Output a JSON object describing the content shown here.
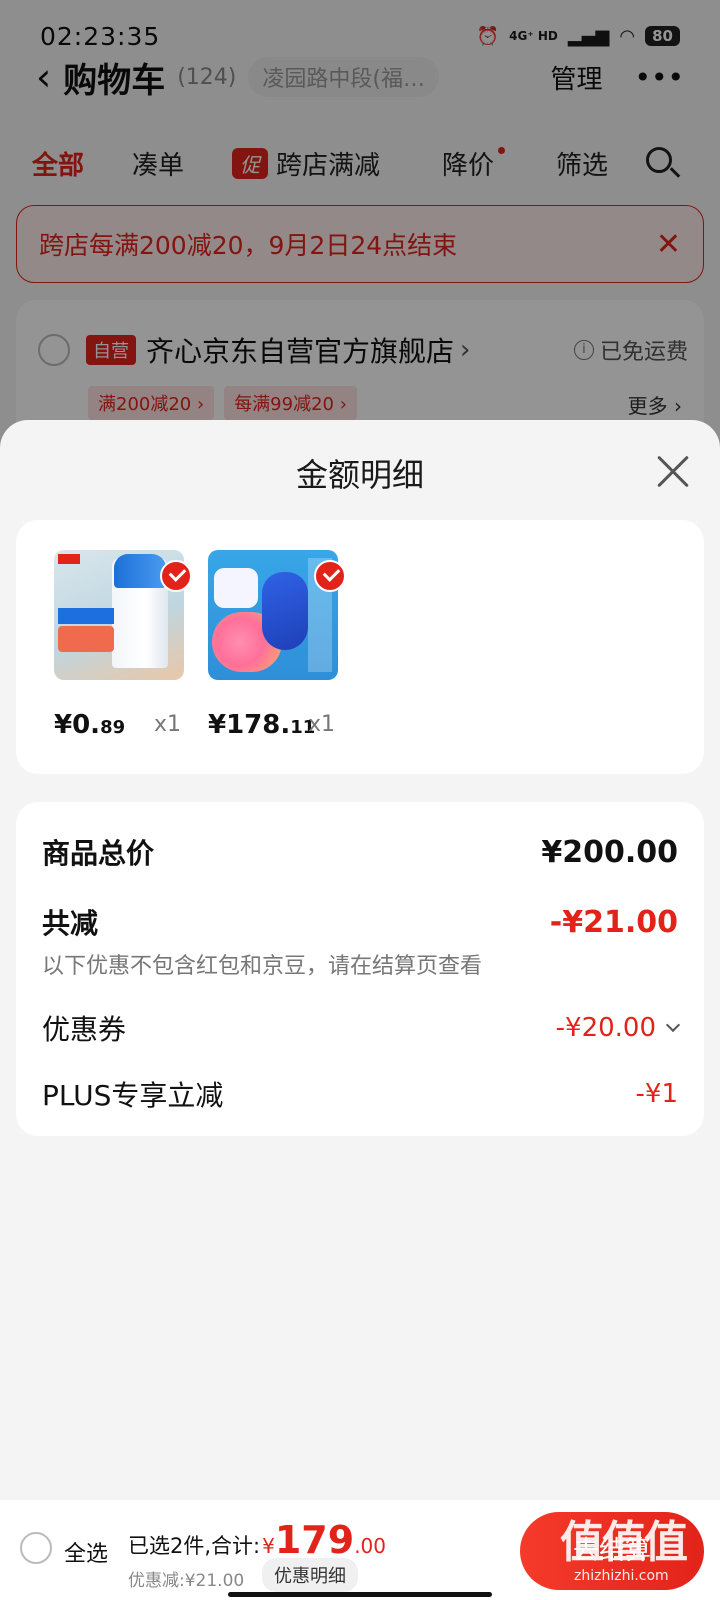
{
  "status_bar": {
    "time": "02:23:35",
    "network": "4G⁺ HD",
    "battery": "80"
  },
  "header": {
    "title": "购物车",
    "count": "(124)",
    "address": "凌园路中段(福…",
    "manage": "管理",
    "more": "•••"
  },
  "tabs": [
    {
      "label": "全部"
    },
    {
      "label": "凑单"
    },
    {
      "label": "跨店满减",
      "badge": "促"
    },
    {
      "label": "降价"
    },
    {
      "label": "筛选"
    }
  ],
  "banner": {
    "text": "跨店每满200减20，9月2日24点结束",
    "close": "✕"
  },
  "store": {
    "badge": "自营",
    "name": "齐心京东自营官方旗舰店",
    "chevron": "›",
    "shipping": "已免运费",
    "coupons": [
      "满200减20 ›",
      "每满99减20 ›"
    ],
    "more": "更多 ›"
  },
  "sheet": {
    "title": "金额明细",
    "goods": [
      {
        "name": "liquid-glue",
        "price_int": "¥0.",
        "price_dec": "89",
        "qty": "x1"
      },
      {
        "name": "wireless-mouse",
        "price_int": "¥178.",
        "price_dec": "11",
        "qty": "x1"
      }
    ],
    "details": {
      "total_label": "商品总价",
      "total_value": "¥200.00",
      "discount_label": "共减",
      "discount_value": "-¥21.00",
      "discount_note": "以下优惠不包含红包和京豆，请在结算页查看",
      "coupon_label": "优惠券",
      "coupon_value": "-¥20.00",
      "plus_label": "PLUS专享立减",
      "plus_value": "-¥1"
    }
  },
  "bottom_bar": {
    "select_all": "全选",
    "summary": "已选2件,合计:",
    "yen": "¥",
    "total_int": "179",
    "total_dec": ".00",
    "discount": "优惠减:¥21.00",
    "detail_button": "优惠明细",
    "checkout": "去结算"
  },
  "watermark": {
    "text": "值值值",
    "sub": "zhizhizhi.com"
  },
  "colors": {
    "accent": "#e2231a",
    "sheet_bg": "#f4f4f4",
    "card_bg": "#ffffff"
  }
}
